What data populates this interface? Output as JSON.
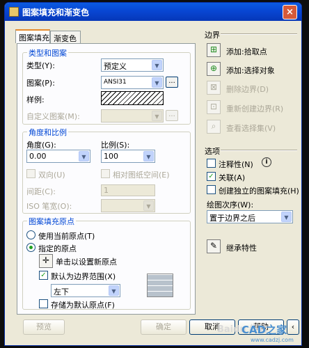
{
  "window": {
    "title": "图案填充和渐变色",
    "close": "×"
  },
  "tabs": [
    {
      "label": "图案填充"
    },
    {
      "label": "渐变色"
    }
  ],
  "type_pattern": {
    "group": "类型和图案",
    "type_label": "类型(Y):",
    "type_value": "预定义",
    "pattern_label": "图案(P):",
    "pattern_value": "ANSI31",
    "swatch_label": "样例:",
    "custom_label": "自定义图案(M):",
    "dots": "..."
  },
  "angle_scale": {
    "group": "角度和比例",
    "angle_label": "角度(G):",
    "angle_value": "0.00",
    "scale_label": "比例(S):",
    "scale_value": "100",
    "double_label": "双向(U)",
    "relative_label": "相对图纸空间(E)",
    "spacing_label": "间距(C):",
    "spacing_value": "1",
    "iso_label": "ISO 笔宽(O):"
  },
  "origin": {
    "group": "图案填充原点",
    "use_current_label": "使用当前原点(T)",
    "specified_label": "指定的原点",
    "click_set_label": "单击以设置新原点",
    "default_extents_label": "默认为边界范围(X)",
    "position_value": "左下",
    "store_default_label": "存储为默认原点(F)"
  },
  "boundaries": {
    "title": "边界",
    "pick_points": "添加:拾取点",
    "select_objects": "添加:选择对象",
    "remove": "删除边界(D)",
    "recreate": "重新创建边界(R)",
    "view_selections": "查看选择集(V)"
  },
  "options": {
    "title": "选项",
    "annotative": "注释性(N)",
    "associative": "关联(A)",
    "separate": "创建独立的图案填充(H)",
    "draw_order_label": "绘图次序(W):",
    "draw_order_value": "置于边界之后"
  },
  "inherit": "继承特性",
  "footer": {
    "preview": "预览",
    "ok": "确定",
    "cancel": "取消",
    "help": "帮助"
  },
  "watermark": {
    "text1": "Baidu 经验",
    "text2": "CAD之家",
    "text3": "www.cadzj.com"
  },
  "colors": {
    "accent": "#0046d5",
    "titlebar": "#0846d3",
    "check": "#21a121"
  }
}
